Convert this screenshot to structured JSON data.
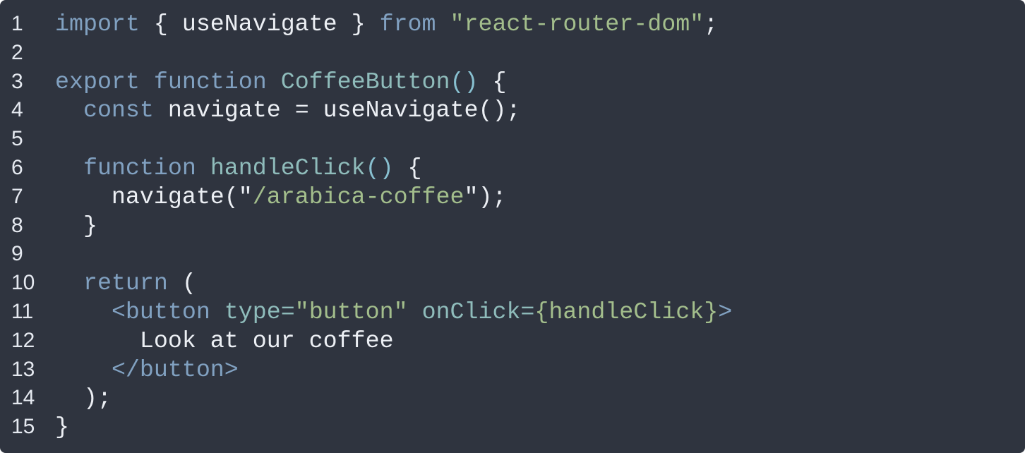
{
  "theme": {
    "background": "#2f343f",
    "keyword": "#81a1c1",
    "function_name": "#8fbcbb",
    "paren": "#88c0d0",
    "string": "#a3be8c",
    "plain": "#eceff4"
  },
  "lines": [
    {
      "number": "1",
      "tokens": [
        {
          "t": "import",
          "c": "kw"
        },
        {
          "t": " { useNavigate } ",
          "c": "punc"
        },
        {
          "t": "from",
          "c": "kw"
        },
        {
          "t": " ",
          "c": "punc"
        },
        {
          "t": "\"react-router-dom\"",
          "c": "str"
        },
        {
          "t": ";",
          "c": "punc"
        }
      ]
    },
    {
      "number": "2",
      "tokens": []
    },
    {
      "number": "3",
      "tokens": [
        {
          "t": "export",
          "c": "kw"
        },
        {
          "t": " ",
          "c": "punc"
        },
        {
          "t": "function",
          "c": "kw"
        },
        {
          "t": " ",
          "c": "punc"
        },
        {
          "t": "CoffeeButton",
          "c": "fn"
        },
        {
          "t": "()",
          "c": "paren"
        },
        {
          "t": " {",
          "c": "punc"
        }
      ]
    },
    {
      "number": "4",
      "tokens": [
        {
          "t": "  ",
          "c": "punc"
        },
        {
          "t": "const",
          "c": "kw"
        },
        {
          "t": " navigate = useNavigate();",
          "c": "punc"
        }
      ]
    },
    {
      "number": "5",
      "tokens": []
    },
    {
      "number": "6",
      "tokens": [
        {
          "t": "  ",
          "c": "punc"
        },
        {
          "t": "function",
          "c": "kw"
        },
        {
          "t": " ",
          "c": "punc"
        },
        {
          "t": "handleClick",
          "c": "fn"
        },
        {
          "t": "()",
          "c": "paren"
        },
        {
          "t": " {",
          "c": "punc"
        }
      ]
    },
    {
      "number": "7",
      "tokens": [
        {
          "t": "    navigate(\"",
          "c": "punc"
        },
        {
          "t": "/arabica-coffee",
          "c": "str"
        },
        {
          "t": "\");",
          "c": "punc"
        }
      ]
    },
    {
      "number": "8",
      "tokens": [
        {
          "t": "  }",
          "c": "punc"
        }
      ]
    },
    {
      "number": "9",
      "tokens": []
    },
    {
      "number": "10",
      "tokens": [
        {
          "t": "  ",
          "c": "punc"
        },
        {
          "t": "return",
          "c": "kw"
        },
        {
          "t": " (",
          "c": "punc"
        }
      ]
    },
    {
      "number": "11",
      "tokens": [
        {
          "t": "    ",
          "c": "punc"
        },
        {
          "t": "<button",
          "c": "tag"
        },
        {
          "t": " ",
          "c": "punc"
        },
        {
          "t": "type=",
          "c": "attr"
        },
        {
          "t": "\"button\"",
          "c": "str"
        },
        {
          "t": " ",
          "c": "punc"
        },
        {
          "t": "onClick=",
          "c": "attr"
        },
        {
          "t": "{handleClick}",
          "c": "str"
        },
        {
          "t": ">",
          "c": "tag"
        }
      ]
    },
    {
      "number": "12",
      "tokens": [
        {
          "t": "      Look at our coffee",
          "c": "text"
        }
      ]
    },
    {
      "number": "13",
      "tokens": [
        {
          "t": "    ",
          "c": "punc"
        },
        {
          "t": "</button>",
          "c": "tag"
        }
      ]
    },
    {
      "number": "14",
      "tokens": [
        {
          "t": "  );",
          "c": "punc"
        }
      ]
    },
    {
      "number": "15",
      "tokens": [
        {
          "t": "}",
          "c": "punc"
        }
      ]
    }
  ]
}
